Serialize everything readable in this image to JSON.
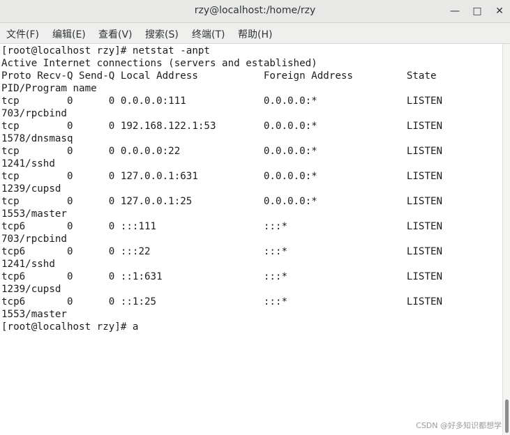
{
  "window": {
    "title": "rzy@localhost:/home/rzy",
    "minimize_glyph": "—",
    "maximize_glyph": "□",
    "close_glyph": "✕"
  },
  "menu": [
    "文件(F)",
    "编辑(E)",
    "查看(V)",
    "搜索(S)",
    "终端(T)",
    "帮助(H)"
  ],
  "terminal": {
    "lines": [
      "[root@localhost rzy]# netstat -anpt",
      "Active Internet connections (servers and established)",
      "Proto Recv-Q Send-Q Local Address           Foreign Address         State",
      "PID/Program name",
      "tcp        0      0 0.0.0.0:111             0.0.0.0:*               LISTEN",
      "703/rpcbind",
      "tcp        0      0 192.168.122.1:53        0.0.0.0:*               LISTEN",
      "1578/dnsmasq",
      "tcp        0      0 0.0.0.0:22              0.0.0.0:*               LISTEN",
      "1241/sshd",
      "tcp        0      0 127.0.0.1:631           0.0.0.0:*               LISTEN",
      "1239/cupsd",
      "tcp        0      0 127.0.0.1:25            0.0.0.0:*               LISTEN",
      "1553/master",
      "tcp6       0      0 :::111                  :::*                    LISTEN",
      "703/rpcbind",
      "tcp6       0      0 :::22                   :::*                    LISTEN",
      "1241/sshd",
      "tcp6       0      0 ::1:631                 :::*                    LISTEN",
      "1239/cupsd",
      "tcp6       0      0 ::1:25                  :::*                    LISTEN",
      "1553/master"
    ],
    "prompt": "[root@localhost rzy]# ",
    "input": "a"
  },
  "watermark": "CSDN @好多知识都想学",
  "colors": {
    "titlebar_bg": "#e8e8e7",
    "menubar_bg": "#efefee",
    "terminal_bg": "#ffffff",
    "terminal_fg": "#1c1c1c"
  }
}
